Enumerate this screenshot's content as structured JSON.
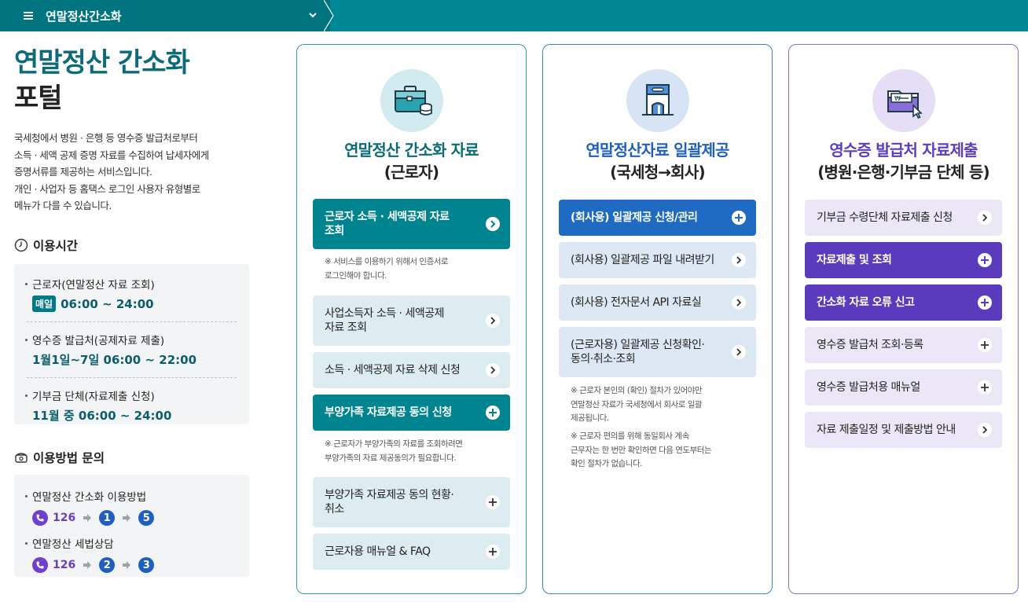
{
  "nav": {
    "breadcrumb": "연말정산간소화"
  },
  "sidebar": {
    "title_line1": "연말정산 간소화",
    "title_line2": "포털",
    "desc": [
      "국세청에서 병원 · 은행 등 영수증 발급처로부터",
      "소득 · 세액 공제 증명 자료를 수집하여 납세자에게",
      "증명서류를 제공하는 서비스입니다.",
      "개인 · 사업자 등 홈택스 로그인 사용자 유형별로",
      "메뉴가 다를 수 있습니다."
    ],
    "hours": {
      "heading": "이용시간",
      "items": [
        {
          "label": "근로자(연말정산 자료 조회)",
          "badge": "매일",
          "value": "06:00 ~ 24:00"
        },
        {
          "label": "영수증 발급처(공제자료 제출)",
          "value": "1월1일~7일 06:00 ~ 22:00"
        },
        {
          "label": "기부금 단체(자료제출 신청)",
          "value": "11월 중 06:00 ~ 24:00"
        }
      ]
    },
    "contact": {
      "heading": "이용방법 문의",
      "items": [
        {
          "label": "연말정산 간소화 이용방법",
          "phone": "126",
          "step1": "1",
          "step2": "5"
        },
        {
          "label": "연말정산 세법상담",
          "phone": "126",
          "step1": "2",
          "step2": "3"
        }
      ]
    }
  },
  "cards": [
    {
      "title": "연말정산 간소화 자료",
      "subtitle": "(근로자)",
      "icon": "briefcase-icon",
      "buttons": [
        {
          "label_line1": "근로자 소득 · 세액공제 자료",
          "label_line2": "조회",
          "icon": "chevron-right"
        },
        {
          "label_line1": "사업소득자 소득 · 세액공제",
          "label_line2": "자료 조회",
          "icon": "chevron-right"
        },
        {
          "label_line1": "소득 · 세액공제 자료 삭제 신청",
          "label_line2": "",
          "icon": "chevron-right"
        },
        {
          "label_line1": "부양가족 자료제공 동의 신청",
          "label_line2": "",
          "icon": "plus"
        },
        {
          "label_line1": "부양가족 자료제공 동의 현황·",
          "label_line2": "취소",
          "icon": "plus"
        },
        {
          "label_line1": "근로자용 매뉴얼 & FAQ",
          "label_line2": "",
          "icon": "plus"
        }
      ],
      "notes": [
        [
          "※ 서비스를 이용하기 위해서 인증서로",
          "로그인해야 합니다."
        ],
        [
          "※ 근로자가 부양가족의 자료를 조회하려면",
          "부양가족의 자료 제공동의가 필요합니다."
        ]
      ]
    },
    {
      "title": "연말정산자료 일괄제공",
      "subtitle": "(국세청→회사)",
      "icon": "building-icon",
      "buttons": [
        {
          "label_line1": "(회사용) 일괄제공 신청/관리",
          "label_line2": "",
          "icon": "plus"
        },
        {
          "label_line1": "(회사용) 일괄제공 파일 내려받기",
          "label_line2": "",
          "icon": "chevron-right"
        },
        {
          "label_line1": "(회사용) 전자문서 API 자료실",
          "label_line2": "",
          "icon": "chevron-right"
        },
        {
          "label_line1": "(근로자용) 일괄제공 신청확인·",
          "label_line2": "동의·취소·조회",
          "icon": "chevron-right"
        }
      ],
      "notes": [
        [
          "※ 근로자 본인의 (확인) 절차가 있어야만",
          "연말정산 자료가 국세청에서 회사로 일괄",
          "제공됩니다."
        ],
        [
          "※ 근로자 편의를 위해 동일회사 계속",
          "근무자는 한 번만 확인하면 다음 연도부터는",
          "확인 절차가 없습니다."
        ]
      ]
    },
    {
      "title": "영수증 발급처 자료제출",
      "subtitle": "(병원·은행·기부금 단체 등)",
      "icon": "folder-cursor-icon",
      "buttons": [
        {
          "label_line1": "기부금 수령단체 자료제출 신청",
          "label_line2": "",
          "icon": "chevron-right"
        },
        {
          "label_line1": "자료제출 및 조회",
          "label_line2": "",
          "icon": "plus"
        },
        {
          "label_line1": "간소화 자료 오류 신고",
          "label_line2": "",
          "icon": "plus"
        },
        {
          "label_line1": "영수증 발급처 조회·등록",
          "label_line2": "",
          "icon": "plus"
        },
        {
          "label_line1": "영수증 발급처용 매뉴얼",
          "label_line2": "",
          "icon": "plus"
        },
        {
          "label_line1": "자료 제출일정 및 제출방법 안내",
          "label_line2": "",
          "icon": "chevron-right"
        }
      ]
    }
  ]
}
